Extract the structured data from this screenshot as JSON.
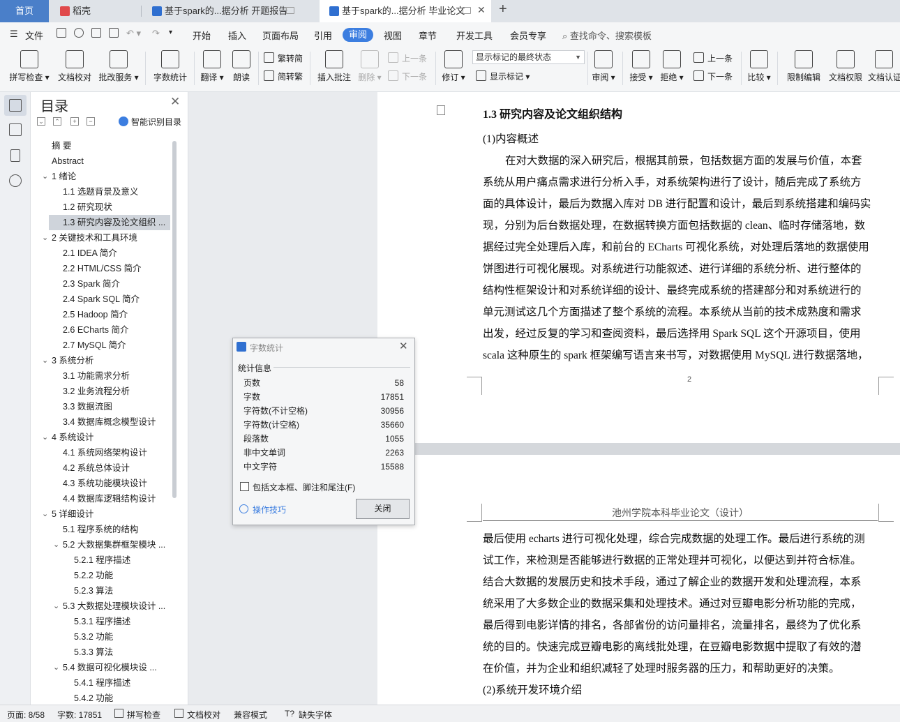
{
  "tabs": {
    "home": "首页",
    "t1": "稻壳",
    "t2": "基于spark的...据分析 开题报告",
    "t3": "基于spark的...据分析 毕业论文"
  },
  "menu": {
    "file": "文件",
    "items": [
      "开始",
      "插入",
      "页面布局",
      "引用",
      "审阅",
      "视图",
      "章节",
      "开发工具",
      "会员专享"
    ],
    "search": "查找命令、搜索模板"
  },
  "ribbon": {
    "spellcheck": "拼写检查",
    "doc_check": "文档校对",
    "annot_service": "批改服务",
    "word_count": "字数统计",
    "translate": "翻译",
    "read_aloud": "朗读",
    "trad": "繁转简",
    "simp": "简转繁",
    "insert_comment": "插入批注",
    "delete": "删除",
    "prev": "上一条",
    "next": "下一条",
    "track": "修订",
    "markup_select": "显示标记的最终状态",
    "show_markup": "显示标记",
    "review": "审阅",
    "accept": "接受",
    "reject": "拒绝",
    "prev2": "上一条",
    "next2": "下一条",
    "compare": "比较",
    "restrict": "限制编辑",
    "doc_perm": "文档权限",
    "doc_cert": "文档认证"
  },
  "toc": {
    "title": "目录",
    "smart": "智能识别目录",
    "items": [
      {
        "text": "摘    要",
        "level": 1,
        "arrow": false
      },
      {
        "text": "Abstract",
        "level": 1,
        "arrow": false
      },
      {
        "text": "1  绪论",
        "level": 1,
        "arrow": true
      },
      {
        "text": "1.1  选题背景及意义",
        "level": 2,
        "arrow": false
      },
      {
        "text": "1.2  研究现状",
        "level": 2,
        "arrow": false
      },
      {
        "text": "1.3  研究内容及论文组织 ...",
        "level": 2,
        "arrow": false,
        "selected": true
      },
      {
        "text": "2  关键技术和工具环境",
        "level": 1,
        "arrow": true
      },
      {
        "text": "2.1 IDEA 简介",
        "level": 2,
        "arrow": false
      },
      {
        "text": "2.2 HTML/CSS 简介",
        "level": 2,
        "arrow": false
      },
      {
        "text": "2.3 Spark 简介",
        "level": 2,
        "arrow": false
      },
      {
        "text": "2.4 Spark SQL 简介",
        "level": 2,
        "arrow": false
      },
      {
        "text": "2.5 Hadoop 简介",
        "level": 2,
        "arrow": false
      },
      {
        "text": "2.6 ECharts 简介",
        "level": 2,
        "arrow": false
      },
      {
        "text": "2.7 MySQL 简介",
        "level": 2,
        "arrow": false
      },
      {
        "text": "3  系统分析",
        "level": 1,
        "arrow": true
      },
      {
        "text": "3.1  功能需求分析",
        "level": 2,
        "arrow": false
      },
      {
        "text": "3.2  业务流程分析",
        "level": 2,
        "arrow": false
      },
      {
        "text": "3.3  数据流图",
        "level": 2,
        "arrow": false
      },
      {
        "text": "3.4  数据库概念模型设计",
        "level": 2,
        "arrow": false
      },
      {
        "text": "4  系统设计",
        "level": 1,
        "arrow": true
      },
      {
        "text": "4.1  系统网络架构设计",
        "level": 2,
        "arrow": false
      },
      {
        "text": "4.2  系统总体设计",
        "level": 2,
        "arrow": false
      },
      {
        "text": "4.3  系统功能模块设计",
        "level": 2,
        "arrow": false
      },
      {
        "text": "4.4  数据库逻辑结构设计",
        "level": 2,
        "arrow": false
      },
      {
        "text": "5  详细设计",
        "level": 1,
        "arrow": true
      },
      {
        "text": "5.1  程序系统的结构",
        "level": 2,
        "arrow": false
      },
      {
        "text": "5.2  大数据集群框架模块 ...",
        "level": 2,
        "arrow": true
      },
      {
        "text": "5.2.1  程序描述",
        "level": 3,
        "arrow": false
      },
      {
        "text": "5.2.2  功能",
        "level": 3,
        "arrow": false
      },
      {
        "text": "5.2.3  算法",
        "level": 3,
        "arrow": false
      },
      {
        "text": "5.3  大数据处理模块设计 ...",
        "level": 2,
        "arrow": true
      },
      {
        "text": "5.3.1  程序描述",
        "level": 3,
        "arrow": false
      },
      {
        "text": "5.3.2  功能",
        "level": 3,
        "arrow": false
      },
      {
        "text": "5.3.3  算法",
        "level": 3,
        "arrow": false
      },
      {
        "text": "5.4    数据可视化模块设 ...",
        "level": 2,
        "arrow": true
      },
      {
        "text": "5.4.1  程序描述",
        "level": 3,
        "arrow": false
      },
      {
        "text": "5.4.2  功能",
        "level": 3,
        "arrow": false
      }
    ]
  },
  "doc": {
    "heading": "1.3  研究内容及论文组织结构",
    "sub1": "(1)内容概述",
    "p1_lines": [
      "在对大数据的深入研究后，根据其前景，包括数据方面的发展与价值，本套",
      "系统从用户痛点需求进行分析入手，对系统架构进行了设计，随后完成了系统方",
      "面的具体设计，最后为数据入库对 DB 进行配置和设计，最后到系统搭建和编码实",
      "现，分别为后台数据处理，在数据转换方面包括数据的 clean、临时存储落地，数",
      "据经过完全处理后入库，和前台的 ECharts 可视化系统，对处理后落地的数据使用",
      "饼图进行可视化展现。对系统进行功能叙述、进行详细的系统分析、进行整体的",
      "结构性框架设计和对系统详细的设计、最终完成系统的搭建部分和对系统进行的",
      "单元测试这几个方面描述了整个系统的流程。本系统从当前的技术成熟度和需求",
      "出发，经过反复的学习和查阅资料，最后选择用 Spark SQL 这个开源项目，使用",
      "scala 这种原生的 spark 框架编写语言来书写，对数据使用 MySQL 进行数据落地，"
    ],
    "page_num": "2",
    "header2": "池州学院本科毕业论文（设计）",
    "p2_lines": [
      "最后使用 echarts 进行可视化处理，综合完成数据的处理工作。最后进行系统的测",
      "试工作，来检测是否能够进行数据的正常处理并可视化，以便达到并符合标准。",
      "结合大数据的发展历史和技术手段，通过了解企业的数据开发和处理流程，本系",
      "统采用了大多数企业的数据采集和处理技术。通过对豆瓣电影分析功能的完成，",
      "最后得到电影详情的排名，各部省份的访问量排名，流量排名，最终为了优化系",
      "统的目的。快速完成豆瓣电影的离线批处理，在豆瓣电影数据中提取了有效的潜",
      "在价值，并为企业和组织减轻了处理时服务器的压力，和帮助更好的决策。",
      "(2)系统开发环境介绍"
    ]
  },
  "dialog": {
    "title": "字数统计",
    "section": "统计信息",
    "rows": [
      {
        "label": "页数",
        "value": "58"
      },
      {
        "label": "字数",
        "value": "17851"
      },
      {
        "label": "字符数(不计空格)",
        "value": "30956"
      },
      {
        "label": "字符数(计空格)",
        "value": "35660"
      },
      {
        "label": "段落数",
        "value": "1055"
      },
      {
        "label": "非中文单词",
        "value": "2263"
      },
      {
        "label": "中文字符",
        "value": "15588"
      }
    ],
    "checkbox": "包括文本框、脚注和尾注(F)",
    "tips": "操作技巧",
    "close": "关闭"
  },
  "status": {
    "page": "页面: 8/58",
    "words": "字数: 17851",
    "spell": "拼写检查",
    "check": "文档校对",
    "compat": "兼容模式",
    "missing_font": "缺失字体"
  },
  "colors": {
    "accent": "#3c7ee0",
    "home_tab": "#4a7fc9"
  }
}
